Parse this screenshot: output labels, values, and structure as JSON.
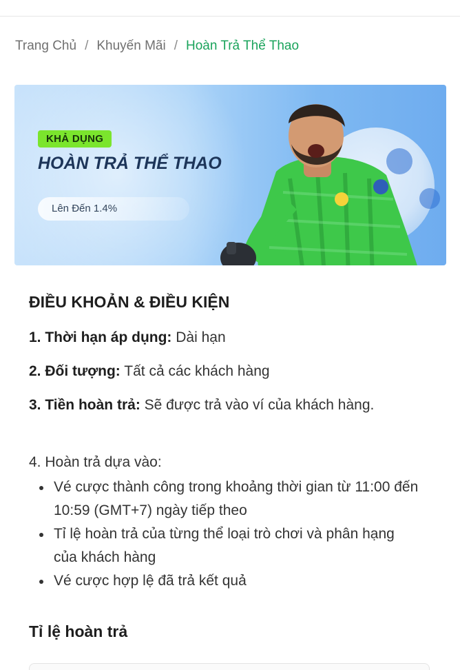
{
  "breadcrumb": {
    "home": "Trang Chủ",
    "separator": "/",
    "promotions": "Khuyến Mãi",
    "current": "Hoàn Trả Thể Thao"
  },
  "banner": {
    "badge": "KHẢ DỤNG",
    "title": "HOÀN TRẢ THỂ THAO",
    "rate": "Lên Đến 1.4%"
  },
  "terms": {
    "title": "ĐIỀU KHOẢN & ĐIỀU KIỆN",
    "items": [
      {
        "label": "1. Thời hạn áp dụng:",
        "value": "Dài hạn"
      },
      {
        "label": "2. Đối tượng:",
        "value": "Tất cả các khách hàng"
      },
      {
        "label": "3. Tiền hoàn trả:",
        "value": "Sẽ được trả vào ví của khách hàng."
      },
      {
        "label": "4. Hoàn trả dựa vào:",
        "value": ""
      }
    ],
    "bullets": [
      "Vé cược thành công trong khoảng thời gian từ 11:00 đến 10:59 (GMT+7) ngày tiếp theo",
      "Tỉ lệ hoàn trả của từng thể loại trò chơi và phân hạng của khách hàng",
      "Vé cược hợp lệ đã trả kết quả"
    ]
  },
  "rates": {
    "title": "Tỉ lệ hoàn trả"
  },
  "colors": {
    "accent": "#1aa35b",
    "badge": "#7be52d",
    "jersey": "#3ec84a"
  }
}
